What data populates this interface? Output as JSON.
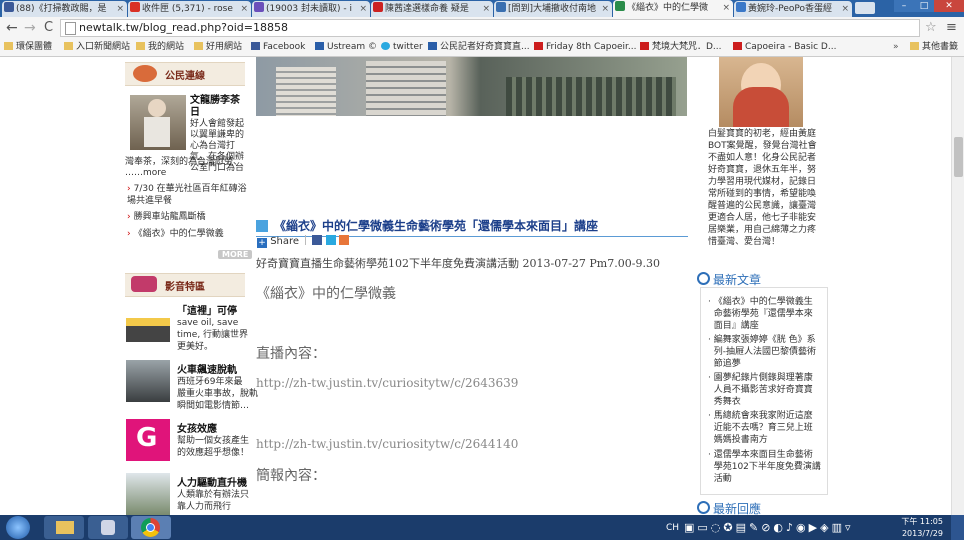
{
  "browser": {
    "tabs": [
      {
        "label": "(88)《打掃教政賜，是",
        "fav_color": "#3b5998"
      },
      {
        "label": "收件匣 (5,371) - rose",
        "fav_color": "#d93025"
      },
      {
        "label": "(19003 封未讀取) - i",
        "fav_color": "#6b4fbb"
      },
      {
        "label": "陳茜達選樣命養 疑是",
        "fav_color": "#cc2222"
      },
      {
        "label": "[問到]大埔撤收付南地",
        "fav_color": "#3a6fb0"
      },
      {
        "label": "《緇衣》中的仁學微",
        "fav_color": "#2a8c4a"
      },
      {
        "label": "黃婉玲-PeoPo香蛋經",
        "fav_color": "#3a78c8"
      }
    ],
    "url": "newtalk.tw/blog_read.php?oid=18858",
    "bookmarks": [
      "環保團體",
      "入口新聞網站",
      "我的網站",
      "好用網站",
      "Facebook",
      "Ustream ©",
      "twitter",
      "公民記者好奇寶寶直...",
      "Friday 8th Capoeir...",
      "梵境大梵咒．D...",
      "Capoeira - Basic D..."
    ],
    "other_bookmarks": "其他書籤"
  },
  "left": {
    "section1_title": "公民連線",
    "feature_title": "文龍勝李茶日",
    "feature_lines": [
      "好人會館發起",
      "以翼單謙卑的",
      "心為台灣打",
      "氣，在各個辦",
      "公室門口為台",
      "灣奉茶，深刻的為台灣慰勞、",
      "……more"
    ],
    "links": [
      "7/30 在華光社區百年紅磚浴場共進早餐",
      "勝興車站龍鳳斷橋",
      "《緇衣》中的仁學微義"
    ],
    "more_label": "MORE",
    "section2_title": "影音特區",
    "videos": [
      {
        "title": "「這裡」可停",
        "desc": [
          "save oil, save",
          "time, 行動讓世界",
          "更美好。"
        ]
      },
      {
        "title": "火車飆速脫軌",
        "desc": [
          "西班牙69年來最",
          "嚴重火車事故，脫軌",
          "瞬間如電影情節…"
        ]
      },
      {
        "title": "女孩效應",
        "desc": [
          "幫助一個女孩產生",
          "的效應超乎想像！"
        ]
      },
      {
        "title": "人力驅動直升機",
        "desc": [
          "人類靠於有辦法只",
          "靠人力而飛行"
        ]
      }
    ]
  },
  "article": {
    "title": "《緇衣》中的仁學微義生命藝術學苑「還儒學本來面目」講座",
    "share_label": "Share",
    "subtitle": "好奇寶寶直播生命藝術學苑102下半年度免費演講活動 2013-07-27 Pm7.00-9.30",
    "heading": "《緇衣》中的仁學微義",
    "live_label": "直播內容：",
    "url1": "http://zh-tw.justin.tv/curiositytw/c/2643639",
    "url2": "http://zh-tw.justin.tv/curiositytw/c/2644140",
    "summary_label": "簡報內容："
  },
  "right": {
    "bio_lines": [
      "白髮寶寶的初老，經由黃庭",
      "BOT案覺醒，發覺台灣社會",
      "不盡如人意！化身公民記者",
      "好奇寶寶，退休五年半，努",
      "力學習用現代媒材，記錄日",
      "常所碰到的事情，希望能喚",
      "醒普遍的公民意識，讓臺灣",
      "更適合人居，他七子非能安",
      "居樂業，用自己綿薄之力疼",
      "惜臺灣、愛台灣！"
    ],
    "latest_title": "最新文章",
    "latest": [
      [
        "《緇衣》中的仁學微義生",
        "命藝術學苑『還儒學本來",
        "面目』講座"
      ],
      [
        "編舞家張婷婷《胱 色》系",
        "列-抽屜人法國巴黎債藝術",
        "節追夢"
      ],
      [
        "園夢紀錄片側錄與理著康",
        "人員不攝影苦求好奇寶寶",
        "秀舞衣"
      ],
      [
        "馬總統會來我家附近這麼",
        "近能不去嗎？育三兒上班",
        "媽媽投書南方"
      ],
      [
        "還儒學本來面目生命藝術",
        "學苑102下半年度免費演講",
        "活動"
      ]
    ],
    "reply_title": "最新回應"
  },
  "taskbar": {
    "lang": "CH",
    "time": "下午 11:05",
    "date": "2013/7/29"
  }
}
